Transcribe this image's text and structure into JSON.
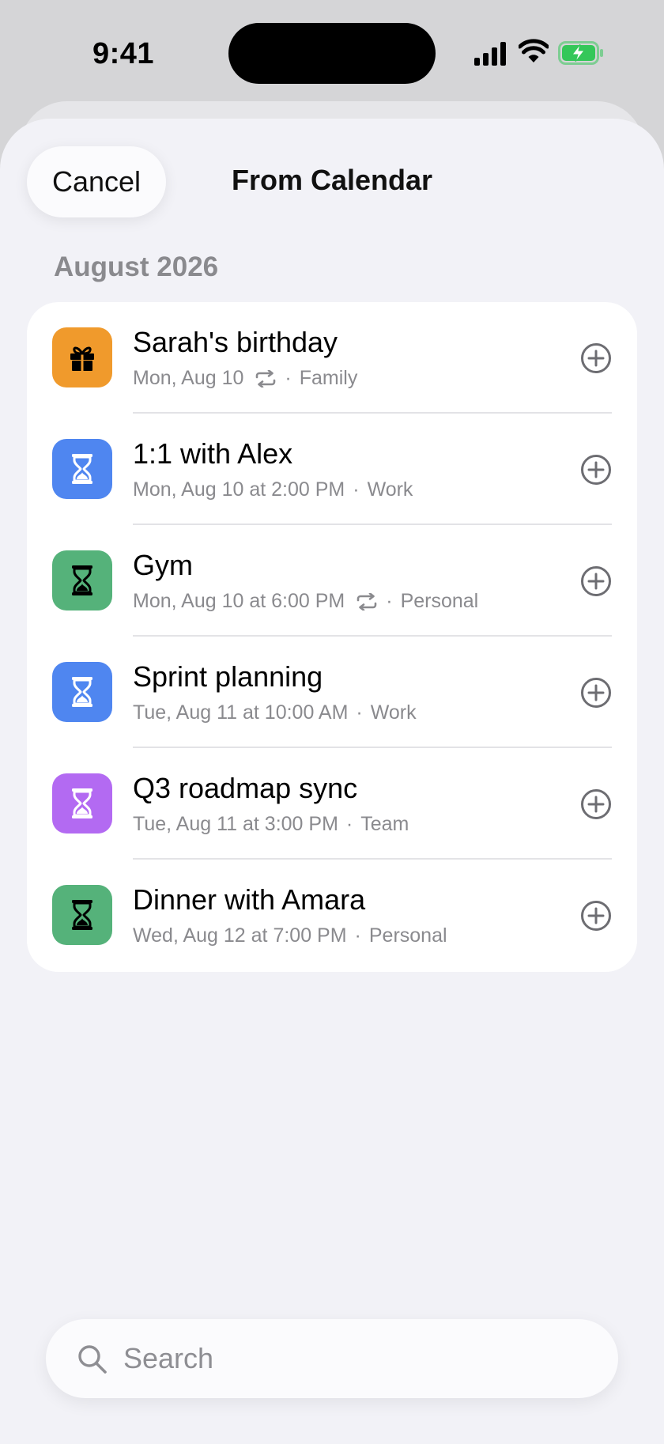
{
  "status_bar": {
    "time": "9:41",
    "icons": [
      "signal-icon",
      "wifi-icon",
      "battery-charging-icon"
    ]
  },
  "nav": {
    "cancel_label": "Cancel",
    "title": "From Calendar"
  },
  "section": {
    "header": "August 2026"
  },
  "events": [
    {
      "title": "Sarah's birthday",
      "when": "Mon, Aug 10",
      "calendar": "Family",
      "repeats": true,
      "icon": "gift-icon",
      "icon_color": "#F09A2C"
    },
    {
      "title": "1:1 with Alex",
      "when": "Mon, Aug 10 at 2:00 PM",
      "calendar": "Work",
      "repeats": false,
      "icon": "hourglass-icon",
      "icon_color": "#4F86F0"
    },
    {
      "title": "Gym",
      "when": "Mon, Aug 10 at 6:00 PM",
      "calendar": "Personal",
      "repeats": true,
      "icon": "hourglass-icon",
      "icon_color": "#55B27A"
    },
    {
      "title": "Sprint planning",
      "when": "Tue, Aug 11 at 10:00 AM",
      "calendar": "Work",
      "repeats": false,
      "icon": "hourglass-icon",
      "icon_color": "#4F86F0"
    },
    {
      "title": "Q3 roadmap sync",
      "when": "Tue, Aug 11 at 3:00 PM",
      "calendar": "Team",
      "repeats": false,
      "icon": "hourglass-icon",
      "icon_color": "#B36AF2"
    },
    {
      "title": "Dinner with Amara",
      "when": "Wed, Aug 12 at 7:00 PM",
      "calendar": "Personal",
      "repeats": false,
      "icon": "hourglass-icon",
      "icon_color": "#55B27A"
    }
  ],
  "search": {
    "placeholder": "Search",
    "value": ""
  },
  "colors": {
    "sheet_background": "#F2F2F7",
    "card_background": "#FFFFFF",
    "secondary_text": "#8A8A8E",
    "battery_green": "#34C759"
  }
}
